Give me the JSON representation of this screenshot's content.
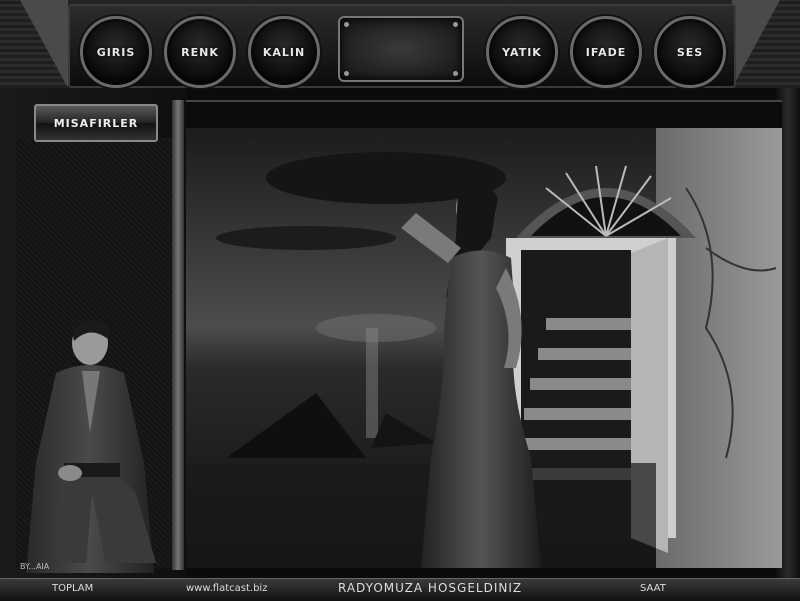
{
  "menu": {
    "items": [
      {
        "label": "GIRIS"
      },
      {
        "label": "RENK"
      },
      {
        "label": "KALIN"
      },
      {
        "label": "YATIK"
      },
      {
        "label": "IFADE"
      },
      {
        "label": "SES"
      }
    ]
  },
  "sidebar": {
    "guests_label": "MISAFIRLER",
    "credit": "BY...AIA"
  },
  "footer": {
    "total_label": "TOPLAM",
    "website": "www.flatcast.biz",
    "welcome": "RADYOMUZA  HOSGELDINIZ",
    "clock_label": "SAAT"
  }
}
